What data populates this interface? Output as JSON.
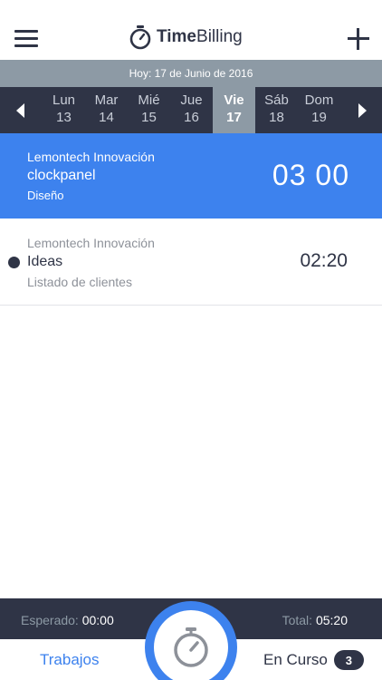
{
  "header": {
    "brand_time": "Time",
    "brand_billing": "Billing",
    "menu_icon": "hamburger-menu-icon",
    "add_icon": "plus-icon",
    "brand_icon": "stopwatch-icon"
  },
  "date_bar": {
    "today": "Hoy: 17 de Junio de 2016"
  },
  "week": {
    "prev_icon": "chevron-left-icon",
    "next_icon": "chevron-right-icon",
    "selected_index": 4,
    "days": [
      {
        "name": "Lun",
        "num": "13"
      },
      {
        "name": "Mar",
        "num": "14"
      },
      {
        "name": "Mié",
        "num": "15"
      },
      {
        "name": "Jue",
        "num": "16"
      },
      {
        "name": "Vie",
        "num": "17"
      },
      {
        "name": "Sáb",
        "num": "18"
      },
      {
        "name": "Dom",
        "num": "19"
      }
    ]
  },
  "entries": [
    {
      "client": "Lemontech Innovación",
      "task": "clockpanel",
      "subtitle": "Diseño",
      "time": "03 00",
      "active": true
    },
    {
      "client": "Lemontech Innovación",
      "task": "Ideas",
      "subtitle": "Listado de clientes",
      "time": "02:20",
      "active": false
    }
  ],
  "summary": {
    "expected_label": "Esperado:",
    "expected_value": "00:00",
    "total_label": "Total:",
    "total_value": "05:20"
  },
  "tabbar": {
    "trabajos": "Trabajos",
    "en_curso": "En Curso",
    "en_curso_count": "3",
    "timer_icon": "stopwatch-icon"
  },
  "colors": {
    "accent": "#3d82ee",
    "navy": "#2f3446",
    "slate": "#8d9aa5"
  }
}
